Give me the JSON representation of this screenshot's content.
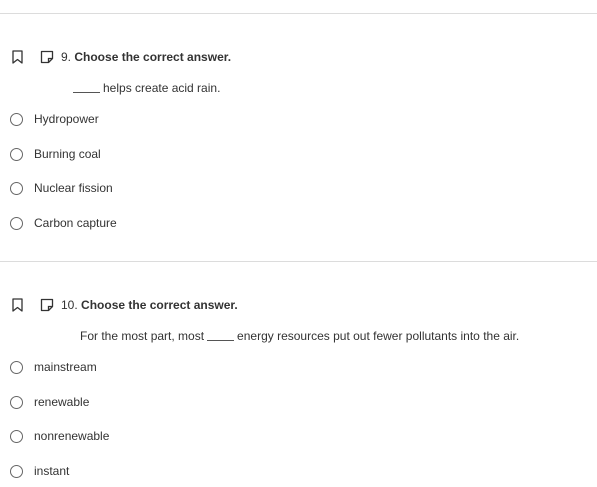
{
  "questions": [
    {
      "number": "9.",
      "instruction": "Choose the correct answer.",
      "prompt_after_blank": "helps create acid rain.",
      "options": [
        "Hydropower",
        "Burning coal",
        "Nuclear fission",
        "Carbon capture"
      ]
    },
    {
      "number": "10.",
      "instruction": "Choose the correct answer.",
      "prompt_before_blank": "For the most part, most",
      "prompt_after_blank": "energy resources put out fewer pollutants into the air.",
      "options": [
        "mainstream",
        "renewable",
        "nonrenewable",
        "instant"
      ]
    }
  ],
  "icons": {
    "bookmark": "bookmark-icon",
    "note": "note-icon"
  },
  "colors": {
    "text": "#333333",
    "divider": "#dcdcdc",
    "radio_border": "#666666"
  }
}
